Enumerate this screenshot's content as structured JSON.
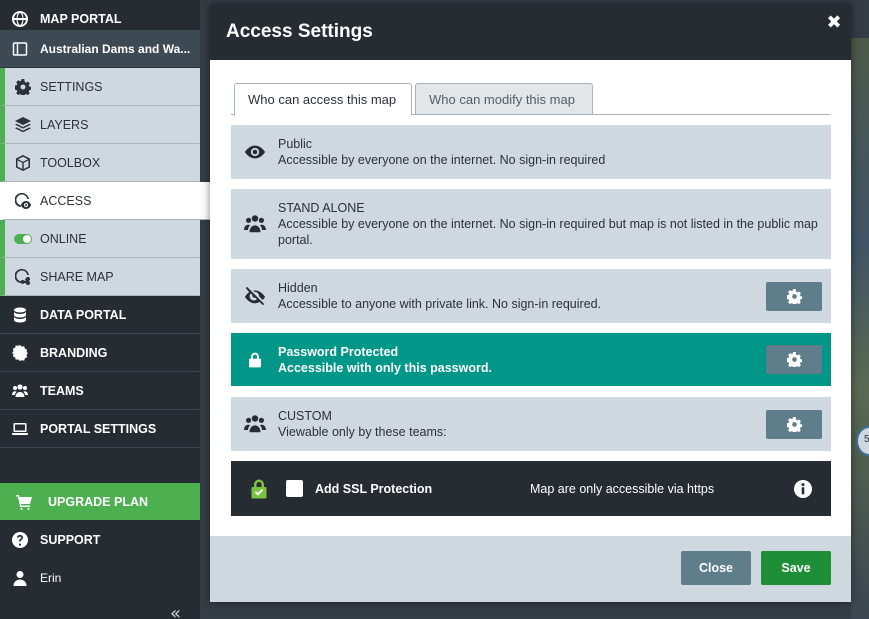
{
  "sidebar": {
    "map_portal": "MAP PORTAL",
    "map_name": "Australian Dams and Wa...",
    "settings": "SETTINGS",
    "layers": "LAYERS",
    "toolbox": "TOOLBOX",
    "access": "ACCESS",
    "online": "ONLINE",
    "share_map": "SHARE MAP",
    "data_portal": "DATA PORTAL",
    "branding": "BRANDING",
    "teams": "TEAMS",
    "portal_settings": "PORTAL SETTINGS",
    "upgrade_plan": "UPGRADE PLAN",
    "support": "SUPPORT",
    "user": "Erin",
    "collapse_glyph": "«"
  },
  "map": {
    "marker_label": "5"
  },
  "modal": {
    "title": "Access Settings",
    "close_glyph": "✖",
    "tabs": {
      "access": "Who can access this map",
      "modify": "Who can modify this map"
    },
    "options": {
      "public": {
        "title": "Public",
        "desc": "Accessible by everyone on the internet. No sign-in required"
      },
      "standalone": {
        "title": "STAND ALONE",
        "desc": "Accessible by everyone on the internet. No sign-in required but map is not listed in the public map portal."
      },
      "hidden": {
        "title": "Hidden",
        "desc": "Accessible to anyone with private link. No sign-in required."
      },
      "password": {
        "title": "Password Protected",
        "desc": "Accessible with only this password."
      },
      "custom": {
        "title": "CUSTOM",
        "desc": "Viewable only by these teams:"
      }
    },
    "ssl": {
      "label": "Add SSL Protection",
      "desc": "Map are only accessible via https",
      "checked": false
    },
    "footer": {
      "close": "Close",
      "save": "Save"
    }
  },
  "colors": {
    "selected_option": "#009688",
    "accent_green": "#4caf50",
    "save_button": "#1e8f36",
    "gear_button": "#607d8b"
  }
}
